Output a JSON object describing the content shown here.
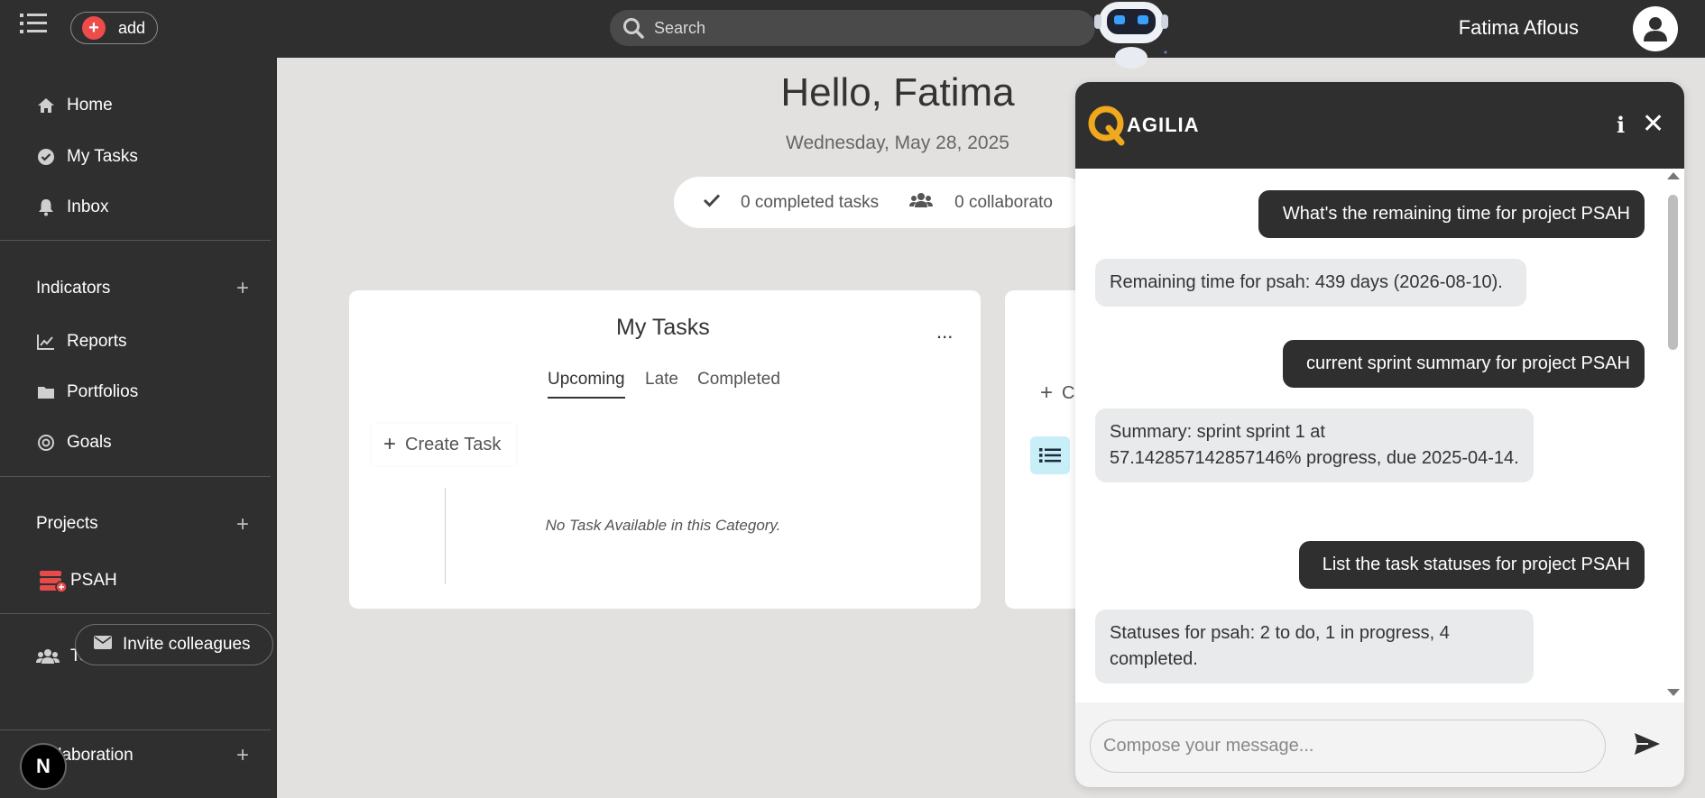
{
  "topbar": {
    "add_label": "add",
    "search_placeholder": "Search",
    "user_name": "Fatima Aflous"
  },
  "sidebar": {
    "nav": [
      {
        "label": "Home",
        "icon": "home-icon"
      },
      {
        "label": "My Tasks",
        "icon": "check-circle-icon"
      },
      {
        "label": "Inbox",
        "icon": "bell-icon"
      }
    ],
    "indicators_title": "Indicators",
    "indicators": [
      {
        "label": "Reports",
        "icon": "chart-line-icon"
      },
      {
        "label": "Portfolios",
        "icon": "folder-icon"
      },
      {
        "label": "Goals",
        "icon": "target-icon"
      }
    ],
    "projects_title": "Projects",
    "projects": [
      {
        "label": "PSAH",
        "icon": "project-icon"
      }
    ],
    "teams_label": "Teams",
    "invite_label": "Invite colleagues",
    "collaboration_label": "llaboration",
    "n_badge": "N"
  },
  "main": {
    "greeting": "Hello, Fatima",
    "date": "Wednesday, May 28, 2025",
    "stats": {
      "completed": "0 completed tasks",
      "collaborators": "0 collaborato"
    },
    "my_tasks_card": {
      "title": "My Tasks",
      "menu": "...",
      "tabs": [
        "Upcoming",
        "Late",
        "Completed"
      ],
      "active_tab": "Upcoming",
      "create_label": "Create Task",
      "empty_message": "No Task Available in this Category."
    },
    "second_card": {
      "create_partial": "C"
    }
  },
  "chat": {
    "brand": "AGILIA",
    "brand_color": "#f0a81c",
    "info": "i",
    "close": "✕",
    "messages": [
      {
        "role": "user",
        "text": "What's the remaining time for project PSAH"
      },
      {
        "role": "bot",
        "text": "Remaining time for psah: 439 days (2026-08-10)."
      },
      {
        "role": "user",
        "text": "current sprint summary for project PSAH"
      },
      {
        "role": "bot",
        "text": "Summary: sprint sprint 1 at 57.142857142857146% progress, due 2025-04-14."
      },
      {
        "role": "user",
        "text": "List the task statuses for project PSAH"
      },
      {
        "role": "bot",
        "text": "Statuses for psah: 2 to do, 1 in progress, 4 completed."
      }
    ],
    "input_placeholder": "Compose your message..."
  }
}
